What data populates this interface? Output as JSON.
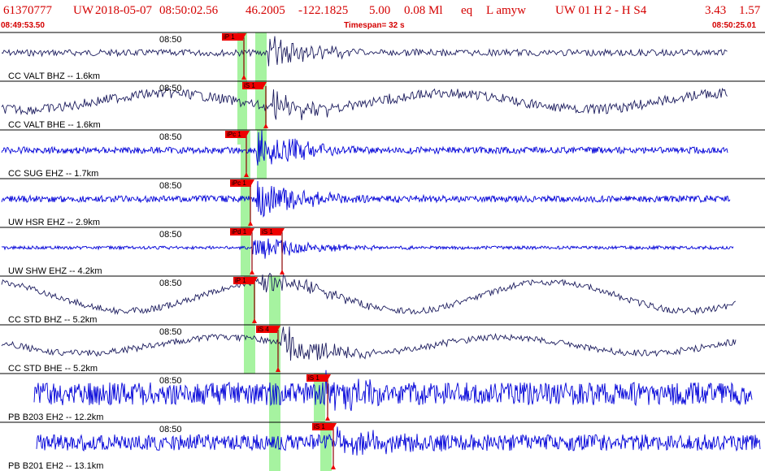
{
  "header": {
    "event_id": "61370777",
    "network": "UW",
    "date": "2018-05-07",
    "time": "08:50:02.56",
    "lat": "46.2005",
    "lon": "-122.1825",
    "depth": "5.00",
    "magnitude": "0.08 Ml",
    "event_type": "eq",
    "flags": "L amyw",
    "status": "UW 01 H 2 - H S4",
    "val1": "3.43",
    "val2": "1.57"
  },
  "timebar": {
    "start": "08:49:53.50",
    "timespan": "Timespan=  32 s",
    "end": "08:50:25.01"
  },
  "colors": {
    "header_text": "#d40000",
    "trace_dark": "#1c1c5e",
    "trace_blue": "#0000d8",
    "pick_flag": "#ee0000",
    "pick_band": "#a6f3a0",
    "pick_line": "#8c0000",
    "divider": "#000000"
  },
  "channels": [
    {
      "label": "CC VALT BHZ -- 1.6km",
      "time_tick": "08:50",
      "color": "dark",
      "picks": [
        "iP 1"
      ]
    },
    {
      "label": "CC VALT BHE -- 1.6km",
      "time_tick": "08:50",
      "color": "dark",
      "picks": [
        "iS 1"
      ]
    },
    {
      "label": "CC SUG EHZ -- 1.7km",
      "time_tick": "08:50",
      "color": "blue",
      "picks": [
        "iPc 1"
      ]
    },
    {
      "label": "UW HSR EHZ -- 2.9km",
      "time_tick": "08:50",
      "color": "blue",
      "picks": [
        "iPc 1"
      ]
    },
    {
      "label": "UW SHW EHZ -- 4.2km",
      "time_tick": "08:50",
      "color": "blue",
      "picks": [
        "iPd 1",
        "iS 1"
      ]
    },
    {
      "label": "CC STD BHZ -- 5.2km",
      "time_tick": "08:50",
      "color": "dark",
      "picks": [
        "iP 1"
      ]
    },
    {
      "label": "CC STD BHE -- 5.2km",
      "time_tick": "08:50",
      "color": "dark",
      "picks": [
        "iS 4"
      ]
    },
    {
      "label": "PB B203 EH2 -- 12.2km",
      "time_tick": "08:50",
      "color": "blue",
      "picks": [
        "iS 1"
      ]
    },
    {
      "label": "PB B201 EH2 -- 13.1km",
      "time_tick": "08:50",
      "color": "blue",
      "picks": [
        "iS 1"
      ]
    }
  ]
}
